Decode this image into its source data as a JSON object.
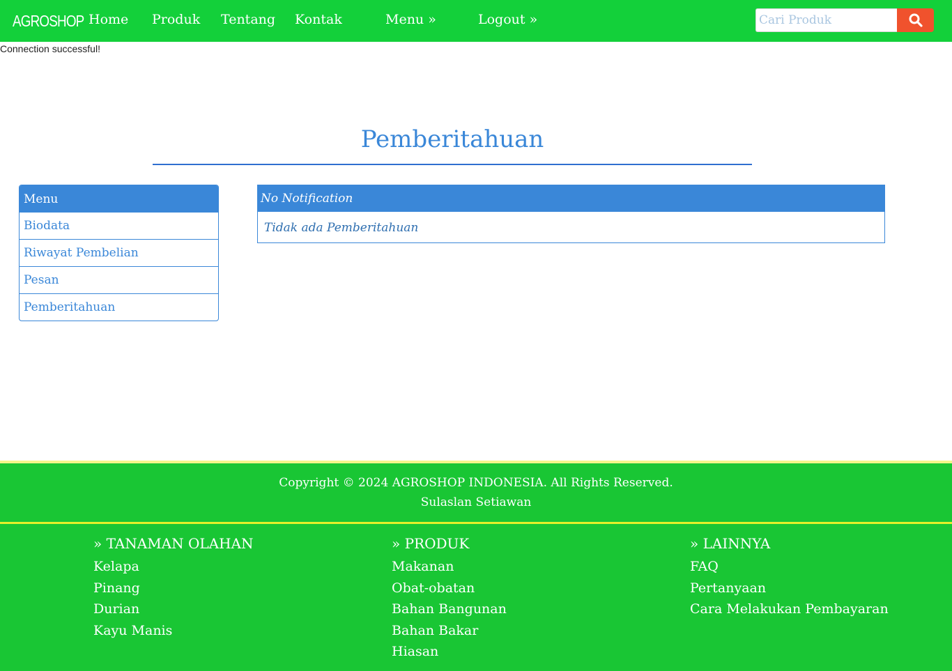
{
  "navbar": {
    "brand": "AGROSHOP",
    "links": [
      "Home",
      "Produk",
      "Tentang",
      "Kontak",
      "Menu »",
      "Logout »"
    ],
    "search_placeholder": "Cari Produk",
    "search_icon": "search-icon",
    "color": "#13d03a",
    "search_button_color": "#f0522d"
  },
  "status_message": "Connection successful!",
  "page_title": "Pemberitahuan",
  "side_menu": {
    "header": "Menu",
    "items": [
      "Biodata",
      "Riwayat Pembelian",
      "Pesan",
      "Pemberitahuan"
    ]
  },
  "notification_panel": {
    "header": "No Notification",
    "body": "Tidak ada Pemberitahuan"
  },
  "footer": {
    "copyright": "Copyright © 2024 AGROSHOP INDONESIA. All Rights Reserved.",
    "author": "Sulaslan Setiawan",
    "columns": [
      {
        "heading": "» TANAMAN OLAHAN",
        "links": [
          "Kelapa",
          "Pinang",
          "Durian",
          "Kayu Manis"
        ]
      },
      {
        "heading": "» PRODUK",
        "links": [
          "Makanan",
          "Obat-obatan",
          "Bahan Bangunan",
          "Bahan Bakar",
          "Hiasan"
        ]
      },
      {
        "heading": "» LAINNYA",
        "links": [
          "FAQ",
          "Pertanyaan",
          "Cara Melakukan Pembayaran"
        ]
      }
    ],
    "color": "#19c634"
  },
  "accent_color": "#3a87d8"
}
